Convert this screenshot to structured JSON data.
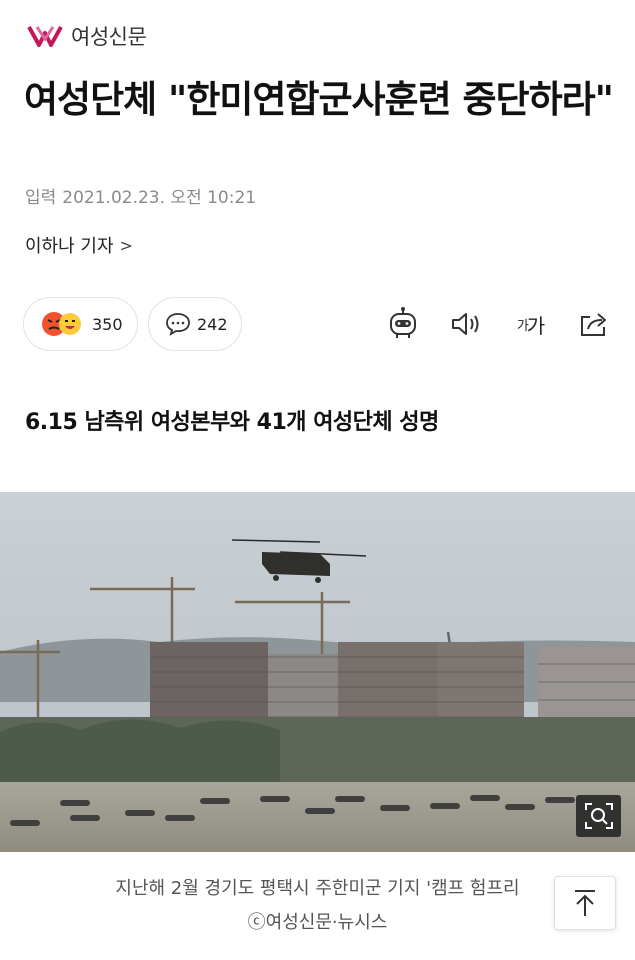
{
  "header": {
    "brand": "여성신문",
    "logo_icon": "ys-logo-icon",
    "brand_color": "#c2185b"
  },
  "article": {
    "title": "여성단체 \"한미연합군사훈련 중단하라\"",
    "date_prefix": "입력",
    "date": "2021.02.23. 오전 10:21",
    "reporter": "이하나 기자"
  },
  "reactions": {
    "emoji_count": "350",
    "comment_count": "242"
  },
  "tools": [
    "robot-read-icon",
    "speaker-icon",
    "font-size-icon",
    "share-icon"
  ],
  "font_size_label": "가가",
  "subtitle": "6.15 남측위 여성본부와 41개 여성단체 성명",
  "photo": {
    "caption_line1": "지난해 2월 경기도 평택시 주한미군 기지 '캠프 험프리",
    "caption_line2": "ⓒ여성신문·뉴시스"
  }
}
